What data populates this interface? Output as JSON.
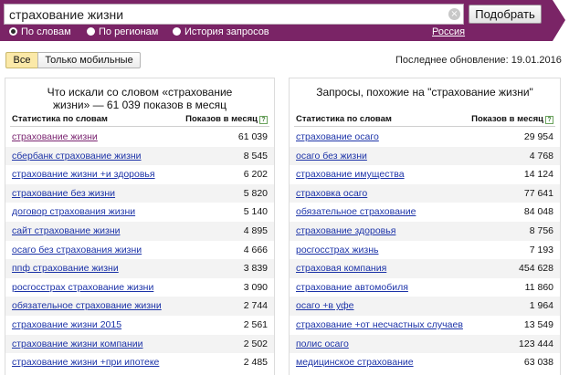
{
  "search": {
    "query": "страхование жизни",
    "submit_label": "Подобрать",
    "clear_symbol": "×"
  },
  "modes": [
    {
      "label": "По словам",
      "selected": true
    },
    {
      "label": "По регионам",
      "selected": false
    },
    {
      "label": "История запросов",
      "selected": false
    }
  ],
  "region": "Россия",
  "filters": {
    "all_label": "Все",
    "mobile_label": "Только мобильные"
  },
  "last_update": "Последнее обновление: 19.01.2016",
  "left_panel": {
    "title_line1": "Что искали со словом «страхование",
    "title_line2": "жизни» — 61 039 показов в месяц",
    "col_keyword": "Статистика по словам",
    "col_count": "Показов в месяц",
    "help_symbol": "?",
    "rows": [
      {
        "keyword": "страхование жизни",
        "count": "61 039"
      },
      {
        "keyword": "сбербанк страхование жизни",
        "count": "8 545"
      },
      {
        "keyword": "страхование жизни +и здоровья",
        "count": "6 202"
      },
      {
        "keyword": "страхование без жизни",
        "count": "5 820"
      },
      {
        "keyword": "договор страхования жизни",
        "count": "5 140"
      },
      {
        "keyword": "сайт страхование жизни",
        "count": "4 895"
      },
      {
        "keyword": "осаго без страхования жизни",
        "count": "4 666"
      },
      {
        "keyword": "ппф страхование жизни",
        "count": "3 839"
      },
      {
        "keyword": "росгосстрах страхование жизни",
        "count": "3 090"
      },
      {
        "keyword": "обязательное страхование жизни",
        "count": "2 744"
      },
      {
        "keyword": "страхование жизни 2015",
        "count": "2 561"
      },
      {
        "keyword": "страхование жизни компании",
        "count": "2 502"
      },
      {
        "keyword": "страхование жизни +при ипотеке",
        "count": "2 485"
      }
    ]
  },
  "right_panel": {
    "title": "Запросы, похожие на \"страхование жизни\"",
    "col_keyword": "Статистика по словам",
    "col_count": "Показов в месяц",
    "help_symbol": "?",
    "rows": [
      {
        "keyword": "страхование осаго",
        "count": "29 954"
      },
      {
        "keyword": "осаго без жизни",
        "count": "4 768"
      },
      {
        "keyword": "страхование имущества",
        "count": "14 124"
      },
      {
        "keyword": "страховка осаго",
        "count": "77 641"
      },
      {
        "keyword": "обязательное страхование",
        "count": "84 048"
      },
      {
        "keyword": "страхование здоровья",
        "count": "8 756"
      },
      {
        "keyword": "росгосстрах жизнь",
        "count": "7 193"
      },
      {
        "keyword": "страховая компания",
        "count": "454 628"
      },
      {
        "keyword": "страхование автомобиля",
        "count": "11 860"
      },
      {
        "keyword": "осаго +в уфе",
        "count": "1 964"
      },
      {
        "keyword": "страхование +от несчастных случаев",
        "count": "13 549"
      },
      {
        "keyword": "полис осаго",
        "count": "123 444"
      },
      {
        "keyword": "медицинское страхование",
        "count": "63 038"
      }
    ]
  }
}
